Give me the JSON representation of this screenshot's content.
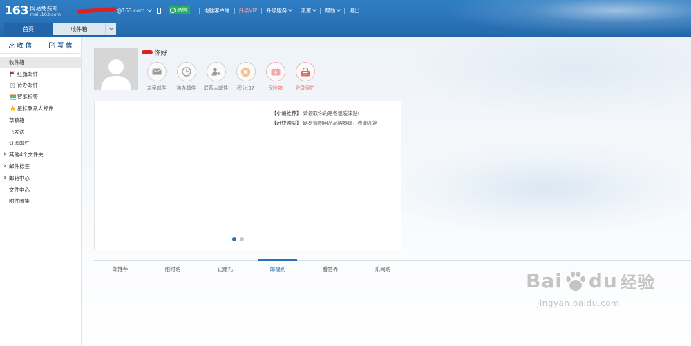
{
  "header": {
    "logo_number": "163",
    "logo_name": "网易免费邮",
    "logo_domain": "mail.163.com",
    "account_suffix": "@163.com",
    "yixin_label": "易信",
    "nav": [
      "电脑客户端",
      "升级VIP",
      "升级服务",
      "设置",
      "帮助",
      "退出"
    ],
    "colors": {
      "topbar": "#2a73b8",
      "vip": "#f5a9b8",
      "yixin": "#27ae60"
    }
  },
  "tabs": {
    "home": "首页",
    "inbox": "收件箱"
  },
  "sidebar": {
    "receive_label": "收 信",
    "write_label": "写 信",
    "folders": [
      {
        "label": "收件箱",
        "icon": ""
      },
      {
        "label": "红旗邮件",
        "icon": "red-flag-icon"
      },
      {
        "label": "待办邮件",
        "icon": "clock-icon"
      },
      {
        "label": "智能标签",
        "icon": "tag-stripes-icon"
      },
      {
        "label": "星标联系人邮件",
        "icon": "star-icon"
      },
      {
        "label": "草稿箱",
        "icon": ""
      },
      {
        "label": "已发送",
        "icon": ""
      },
      {
        "label": "订阅邮件",
        "icon": ""
      },
      {
        "label": "其他4个文件夹",
        "icon": "expand-arrow-icon"
      },
      {
        "label": "邮件标签",
        "icon": "expand-arrow-icon"
      },
      {
        "label": "邮箱中心",
        "icon": "expand-arrow-icon"
      },
      {
        "label": "文件中心",
        "icon": ""
      },
      {
        "label": "附件图集",
        "icon": ""
      }
    ]
  },
  "main": {
    "greeting": "你好",
    "quick_actions": [
      {
        "label": "未读邮件",
        "icon": "envelope-icon"
      },
      {
        "label": "待办邮件",
        "icon": "clock-icon"
      },
      {
        "label": "联系人邮件",
        "icon": "contact-star-icon"
      },
      {
        "label": "积分:37",
        "icon": "points-icon"
      },
      {
        "label": "保险箱",
        "icon": "safe-box-icon"
      },
      {
        "label": "登录保护",
        "icon": "login-protect-icon"
      }
    ],
    "promo": {
      "line1_tag": "【小编推荐】",
      "line1_text": "请领取你的寒冬温暖津贴!",
      "line2_tag": "【赶快购买】",
      "line2_text": "网易情圈用品品牌春风，表潮开箱",
      "active_slide": 1,
      "slide_count": 2
    },
    "bottom_tabs": [
      "邮推荐",
      "限时购",
      "记账礼",
      "邮福利",
      "看世界",
      "乐网购"
    ],
    "active_bottom_tab": 3
  },
  "watermark": {
    "brand_left": "Bai",
    "brand_right": "du",
    "brand_cn": "经验",
    "url": "jingyan.baidu.com"
  }
}
